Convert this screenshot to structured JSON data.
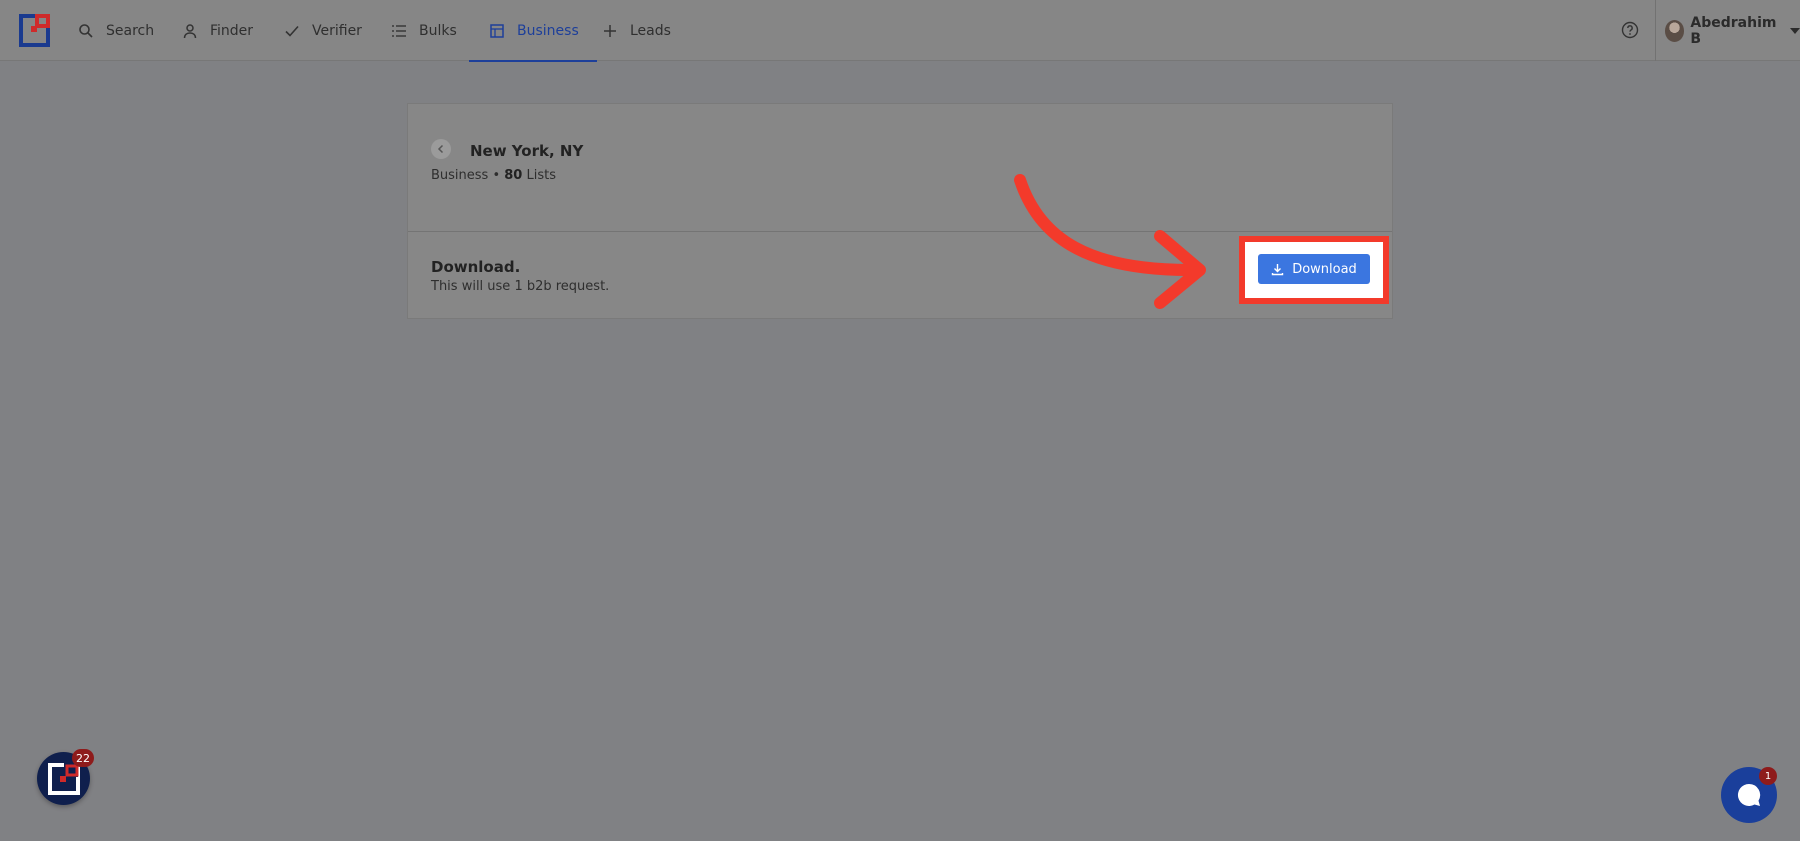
{
  "nav": {
    "items": [
      {
        "label": "Search",
        "icon": "search-icon"
      },
      {
        "label": "Finder",
        "icon": "person-icon"
      },
      {
        "label": "Verifier",
        "icon": "check-icon"
      },
      {
        "label": "Bulks",
        "icon": "list-icon"
      },
      {
        "label": "Business",
        "icon": "building-icon",
        "active": true
      },
      {
        "label": "Leads",
        "icon": "plus-icon"
      }
    ],
    "user_name": "Abedrahim B"
  },
  "card": {
    "title": "New York, NY",
    "sub_prefix": "Business • ",
    "sub_count": "80",
    "sub_suffix": " Lists",
    "download_title": "Download.",
    "download_note": "This will use 1 b2b request.",
    "download_button": "Download"
  },
  "widgets": {
    "app_badge": "22",
    "chat_badge": "1"
  },
  "colors": {
    "accent": "#1d3f9a",
    "button": "#3b76e0",
    "highlight": "#f33a2b",
    "badge": "#8e1b1b"
  }
}
